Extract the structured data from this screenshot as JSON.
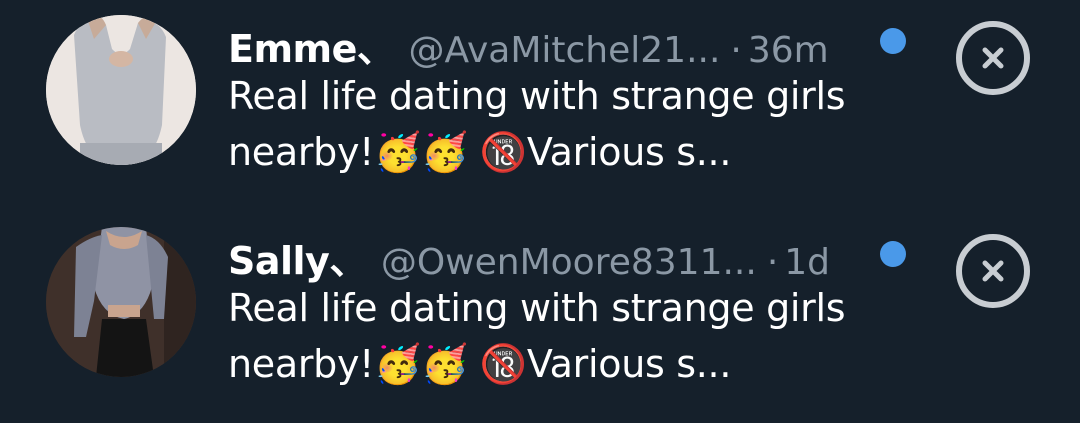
{
  "notifications": [
    {
      "name": "Emme、",
      "handle": "@AvaMitchel21...",
      "separator": "·",
      "time": "36m",
      "message": "Real life dating with strange girls nearby!🥳🥳 🔞Various s...",
      "unread": true,
      "avatar_icon": "profile-photo",
      "dismiss_icon": "close-circle-icon"
    },
    {
      "name": "Sally、",
      "handle": "@OwenMoore8311...",
      "separator": "·",
      "time": "1d",
      "message": "Real life dating with strange girls nearby!🥳🥳 🔞Various s...",
      "unread": true,
      "avatar_icon": "profile-photo",
      "dismiss_icon": "close-circle-icon"
    }
  ],
  "colors": {
    "background": "#15202b",
    "text": "#ffffff",
    "secondary_text": "#8b98a5",
    "unread_dot": "#4a99e9",
    "dismiss": "#c8cdd2"
  }
}
